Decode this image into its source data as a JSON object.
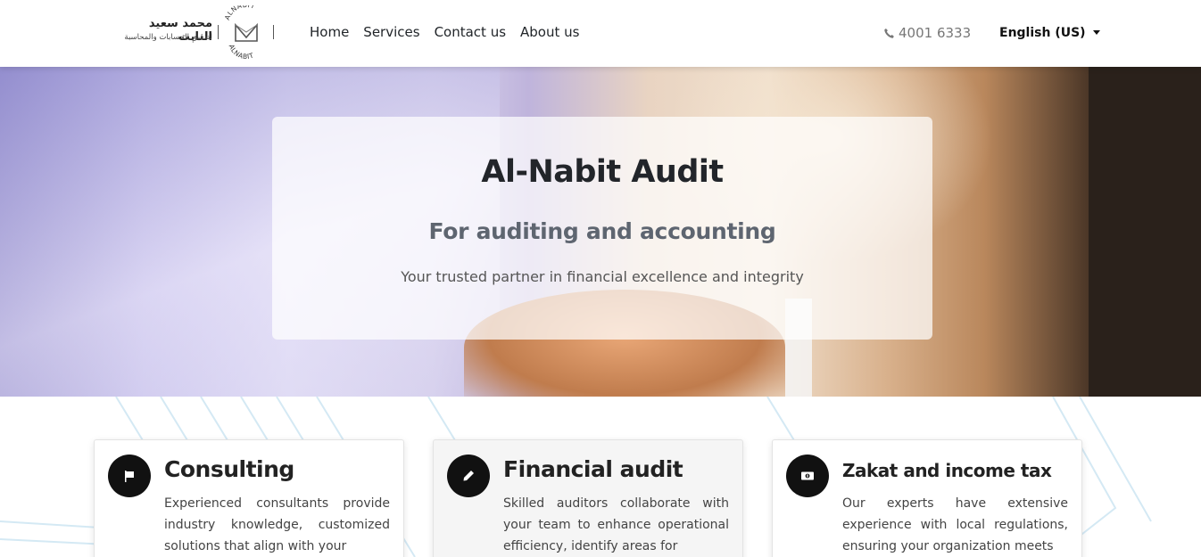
{
  "brand": {
    "arabic_name": "محمد سعيد النابت",
    "arabic_subtitle": "لتدقيق الحسابات والمحاسبة",
    "emblem_text_top": "ALNABIT",
    "emblem_text_bottom": "ALNABIT"
  },
  "nav": {
    "items": [
      {
        "label": "Home"
      },
      {
        "label": "Services"
      },
      {
        "label": "Contact us"
      },
      {
        "label": "About us"
      }
    ],
    "phone": "4001 6333",
    "phone_icon": "phone-icon",
    "language": "English (US)"
  },
  "hero": {
    "title": "Al-Nabit Audit",
    "subtitle": "For auditing and accounting",
    "tagline": "Your trusted partner in financial excellence and integrity"
  },
  "services": {
    "cards": [
      {
        "icon": "flag-icon",
        "title": "Consulting",
        "text": "Experienced consultants provide industry knowledge, customized solutions that align with your"
      },
      {
        "icon": "pencil-icon",
        "title": "Financial audit",
        "text": "Skilled auditors collaborate with your team to enhance operational efficiency, identify areas for"
      },
      {
        "icon": "money-icon",
        "title": "Zakat and income tax",
        "text": "Our experts have extensive experience with local regulations, ensuring your organization meets"
      }
    ]
  },
  "colors": {
    "icon_circle": "#111111",
    "hero_title": "#22252a",
    "hero_subtitle": "#5e6570",
    "phone_text": "#777777",
    "accent_lines": "#cfe6f2"
  }
}
